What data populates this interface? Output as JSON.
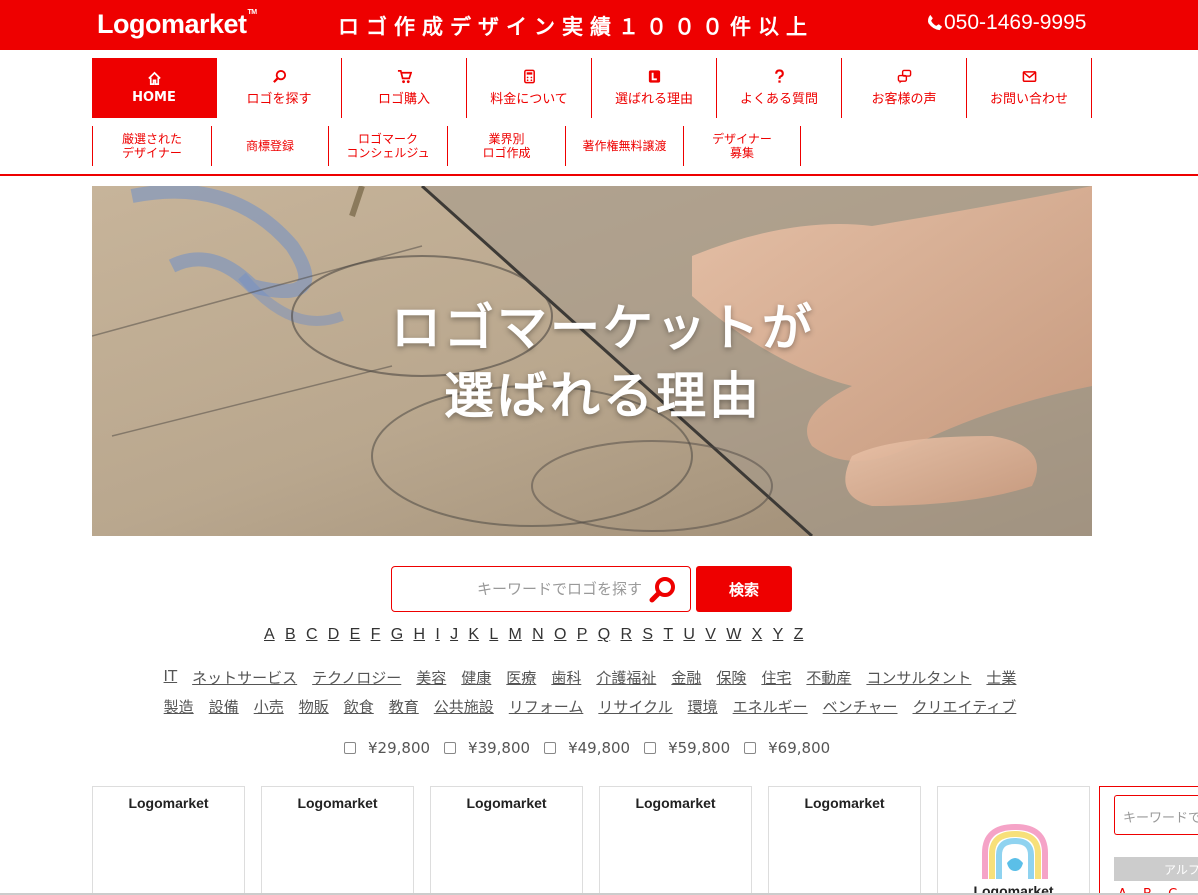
{
  "header": {
    "logo": "Logomarket",
    "tagline": "ロゴ作成デザイン実績１０００件以上",
    "phone": "050-1469-9995"
  },
  "main_nav": [
    {
      "label": "HOME",
      "icon": "home-icon"
    },
    {
      "label": "ロゴを探す",
      "icon": "search-icon"
    },
    {
      "label": "ロゴ購入",
      "icon": "cart-icon"
    },
    {
      "label": "料金について",
      "icon": "calculator-icon"
    },
    {
      "label": "選ばれる理由",
      "icon": "badge-l-icon"
    },
    {
      "label": "よくある質問",
      "icon": "question-icon"
    },
    {
      "label": "お客様の声",
      "icon": "chat-icon"
    },
    {
      "label": "お問い合わせ",
      "icon": "mail-icon"
    }
  ],
  "sub_nav": [
    {
      "line1": "厳選された",
      "line2": "デザイナー"
    },
    {
      "line1": "商標登録",
      "line2": ""
    },
    {
      "line1": "ロゴマーク",
      "line2": "コンシェルジュ"
    },
    {
      "line1": "業界別",
      "line2": "ロゴ作成"
    },
    {
      "line1": "著作権無料譲渡",
      "line2": ""
    },
    {
      "line1": "デザイナー",
      "line2": "募集"
    }
  ],
  "hero": {
    "line1": "ロゴマーケットが",
    "line2": "選ばれる理由"
  },
  "search": {
    "placeholder": "キーワードでロゴを探す",
    "button": "検索"
  },
  "alphabet": [
    "A",
    "B",
    "C",
    "D",
    "E",
    "F",
    "G",
    "H",
    "I",
    "J",
    "K",
    "L",
    "M",
    "N",
    "O",
    "P",
    "Q",
    "R",
    "S",
    "T",
    "U",
    "V",
    "W",
    "X",
    "Y",
    "Z"
  ],
  "categories_row1": [
    "IT",
    "ネットサービス",
    "テクノロジー",
    "美容",
    "健康",
    "医療",
    "歯科",
    "介護福祉",
    "金融",
    "保険",
    "住宅",
    "不動産",
    "コンサルタント",
    "士業"
  ],
  "categories_row2": [
    "製造",
    "設備",
    "小売",
    "物販",
    "飲食",
    "教育",
    "公共施設",
    "リフォーム",
    "リサイクル",
    "環境",
    "エネルギー",
    "ベンチャー",
    "クリエイティブ"
  ],
  "prices": [
    "¥29,800",
    "¥39,800",
    "¥49,800",
    "¥59,800",
    "¥69,800"
  ],
  "cards": [
    {
      "logo": "Logomarket"
    },
    {
      "logo": "Logomarket"
    },
    {
      "logo": "Logomarket"
    },
    {
      "logo": "Logomarket"
    },
    {
      "logo": "Logomarket"
    },
    {
      "logo": "Logomarket"
    }
  ],
  "sidebar": {
    "search_placeholder": "キーワードで",
    "alpha_heading": "アルファベット",
    "alpha_letters": "A B C"
  },
  "colors": {
    "brand_red": "#ee0000"
  }
}
